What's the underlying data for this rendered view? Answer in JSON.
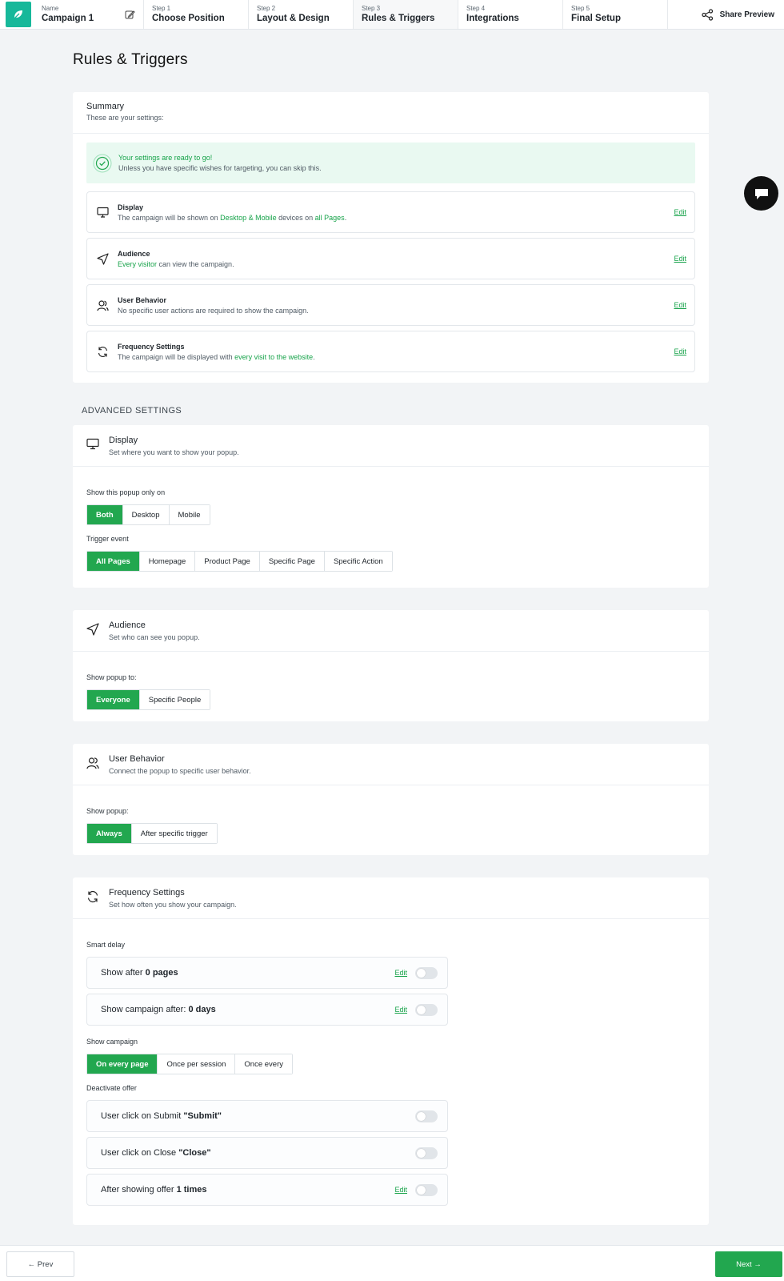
{
  "header": {
    "name_caption": "Name",
    "campaign_name": "Campaign 1",
    "steps": [
      {
        "caption": "Step 1",
        "label": "Choose Position"
      },
      {
        "caption": "Step 2",
        "label": "Layout & Design"
      },
      {
        "caption": "Step 3",
        "label": "Rules & Triggers"
      },
      {
        "caption": "Step 4",
        "label": "Integrations"
      },
      {
        "caption": "Step 5",
        "label": "Final Setup"
      }
    ],
    "share_label": "Share Preview"
  },
  "page_title": "Rules & Triggers",
  "summary": {
    "title": "Summary",
    "subtitle": "These are your settings:",
    "ready_title": "Your settings are ready to go!",
    "ready_sub": "Unless you have specific wishes for targeting, you can skip this.",
    "edit_label": "Edit",
    "display": {
      "title": "Display",
      "t1": "The campaign will be shown on ",
      "h1": "Desktop & Mobile",
      "t2": " devices on ",
      "h2": "all Pages",
      "t3": "."
    },
    "audience": {
      "title": "Audience",
      "h1": "Every visitor",
      "t1": " can view the campaign."
    },
    "behavior": {
      "title": "User Behavior",
      "t1": "No specific user actions are required to show the campaign."
    },
    "frequency": {
      "title": "Frequency Settings",
      "t1": "The campaign will be displayed with ",
      "h1": "every visit to the website",
      "t2": "."
    }
  },
  "advanced_label": "ADVANCED SETTINGS",
  "display_section": {
    "title": "Display",
    "subtitle": "Set where you want to show your popup.",
    "show_label": "Show this popup only on",
    "device_options": [
      "Both",
      "Desktop",
      "Mobile"
    ],
    "device_selected": "Both",
    "trigger_label": "Trigger event",
    "trigger_options": [
      "All Pages",
      "Homepage",
      "Product Page",
      "Specific Page",
      "Specific Action"
    ],
    "trigger_selected": "All Pages"
  },
  "audience_section": {
    "title": "Audience",
    "subtitle": "Set who can see you popup.",
    "show_label": "Show popup to:",
    "options": [
      "Everyone",
      "Specific People"
    ],
    "selected": "Everyone"
  },
  "behavior_section": {
    "title": "User Behavior",
    "subtitle": "Connect the popup to specific user behavior.",
    "show_label": "Show popup:",
    "options": [
      "Always",
      "After specific trigger"
    ],
    "selected": "Always"
  },
  "frequency_section": {
    "title": "Frequency Settings",
    "subtitle": "Set how often you show your campaign.",
    "smart_delay_label": "Smart delay",
    "delay_pages_prefix": "Show after ",
    "delay_pages_value": "0 pages",
    "delay_days_prefix": "Show campaign after: ",
    "delay_days_value": "0 days",
    "edit_label": "Edit",
    "show_campaign_label": "Show campaign",
    "show_options": [
      "On every page",
      "Once per session",
      "Once every"
    ],
    "show_selected": "On every page",
    "deactivate_label": "Deactivate offer",
    "submit_prefix": "User click on Submit ",
    "submit_value": "\"Submit\"",
    "close_prefix": "User click on Close ",
    "close_value": "\"Close\"",
    "after_prefix": "After showing offer ",
    "after_value": "1 times"
  },
  "footer": {
    "prev_label": "← Prev",
    "next_label": "Next →"
  },
  "colors": {
    "accent": "#22a74f",
    "brand": "#17b89a",
    "ready_bg": "#e9f9f1"
  }
}
